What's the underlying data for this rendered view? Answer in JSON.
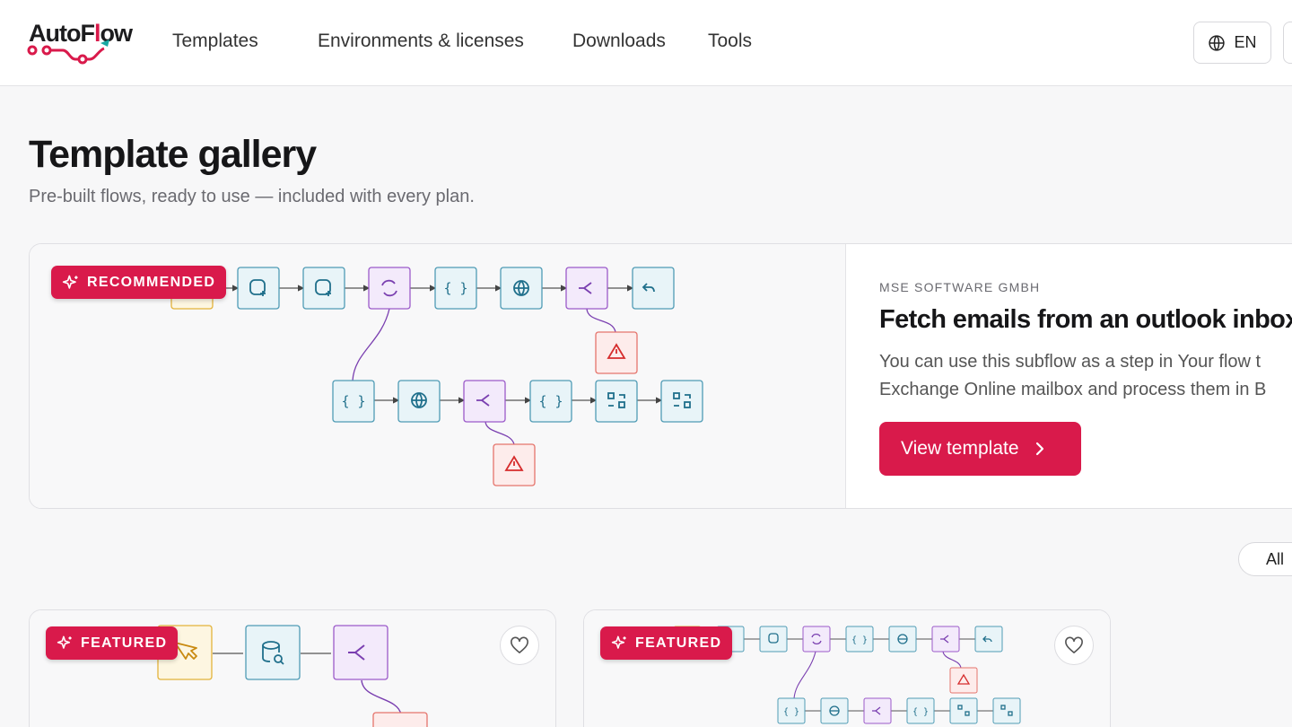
{
  "brand": {
    "name_part1": "AutoF",
    "name_part2": "l",
    "name_part3": "ow"
  },
  "nav": {
    "items": [
      "Templates",
      "Environments & licenses",
      "Downloads",
      "Tools"
    ]
  },
  "language": {
    "label": "EN",
    "icon": "globe-icon"
  },
  "page": {
    "title": "Template gallery",
    "subtitle": "Pre-built flows, ready to use — included with every plan."
  },
  "hero": {
    "badge": "RECOMMENDED",
    "publisher": "MSE SOFTWARE GMBH",
    "title": "Fetch emails from an outlook inbox.",
    "description_line1": "You can use this subflow as a step in Your flow t",
    "description_line2": "Exchange Online mailbox and process them in B",
    "button_label": "View template"
  },
  "filter": {
    "label": "All"
  },
  "cards": [
    {
      "badge": "FEATURED",
      "favorite_icon": "heart-icon"
    },
    {
      "badge": "FEATURED",
      "favorite_icon": "heart-icon"
    }
  ],
  "colors": {
    "accent": "#d91a4b",
    "node_teal_bg": "#e8f4f8",
    "node_teal_border": "#4f9bb5",
    "node_purple_bg": "#f3eafb",
    "node_purple_border": "#9b5ac9",
    "node_red_bg": "#fdeceb",
    "node_red_border": "#e5746c",
    "node_yellow_bg": "#fdf6e1",
    "node_yellow_border": "#e3b33b"
  }
}
